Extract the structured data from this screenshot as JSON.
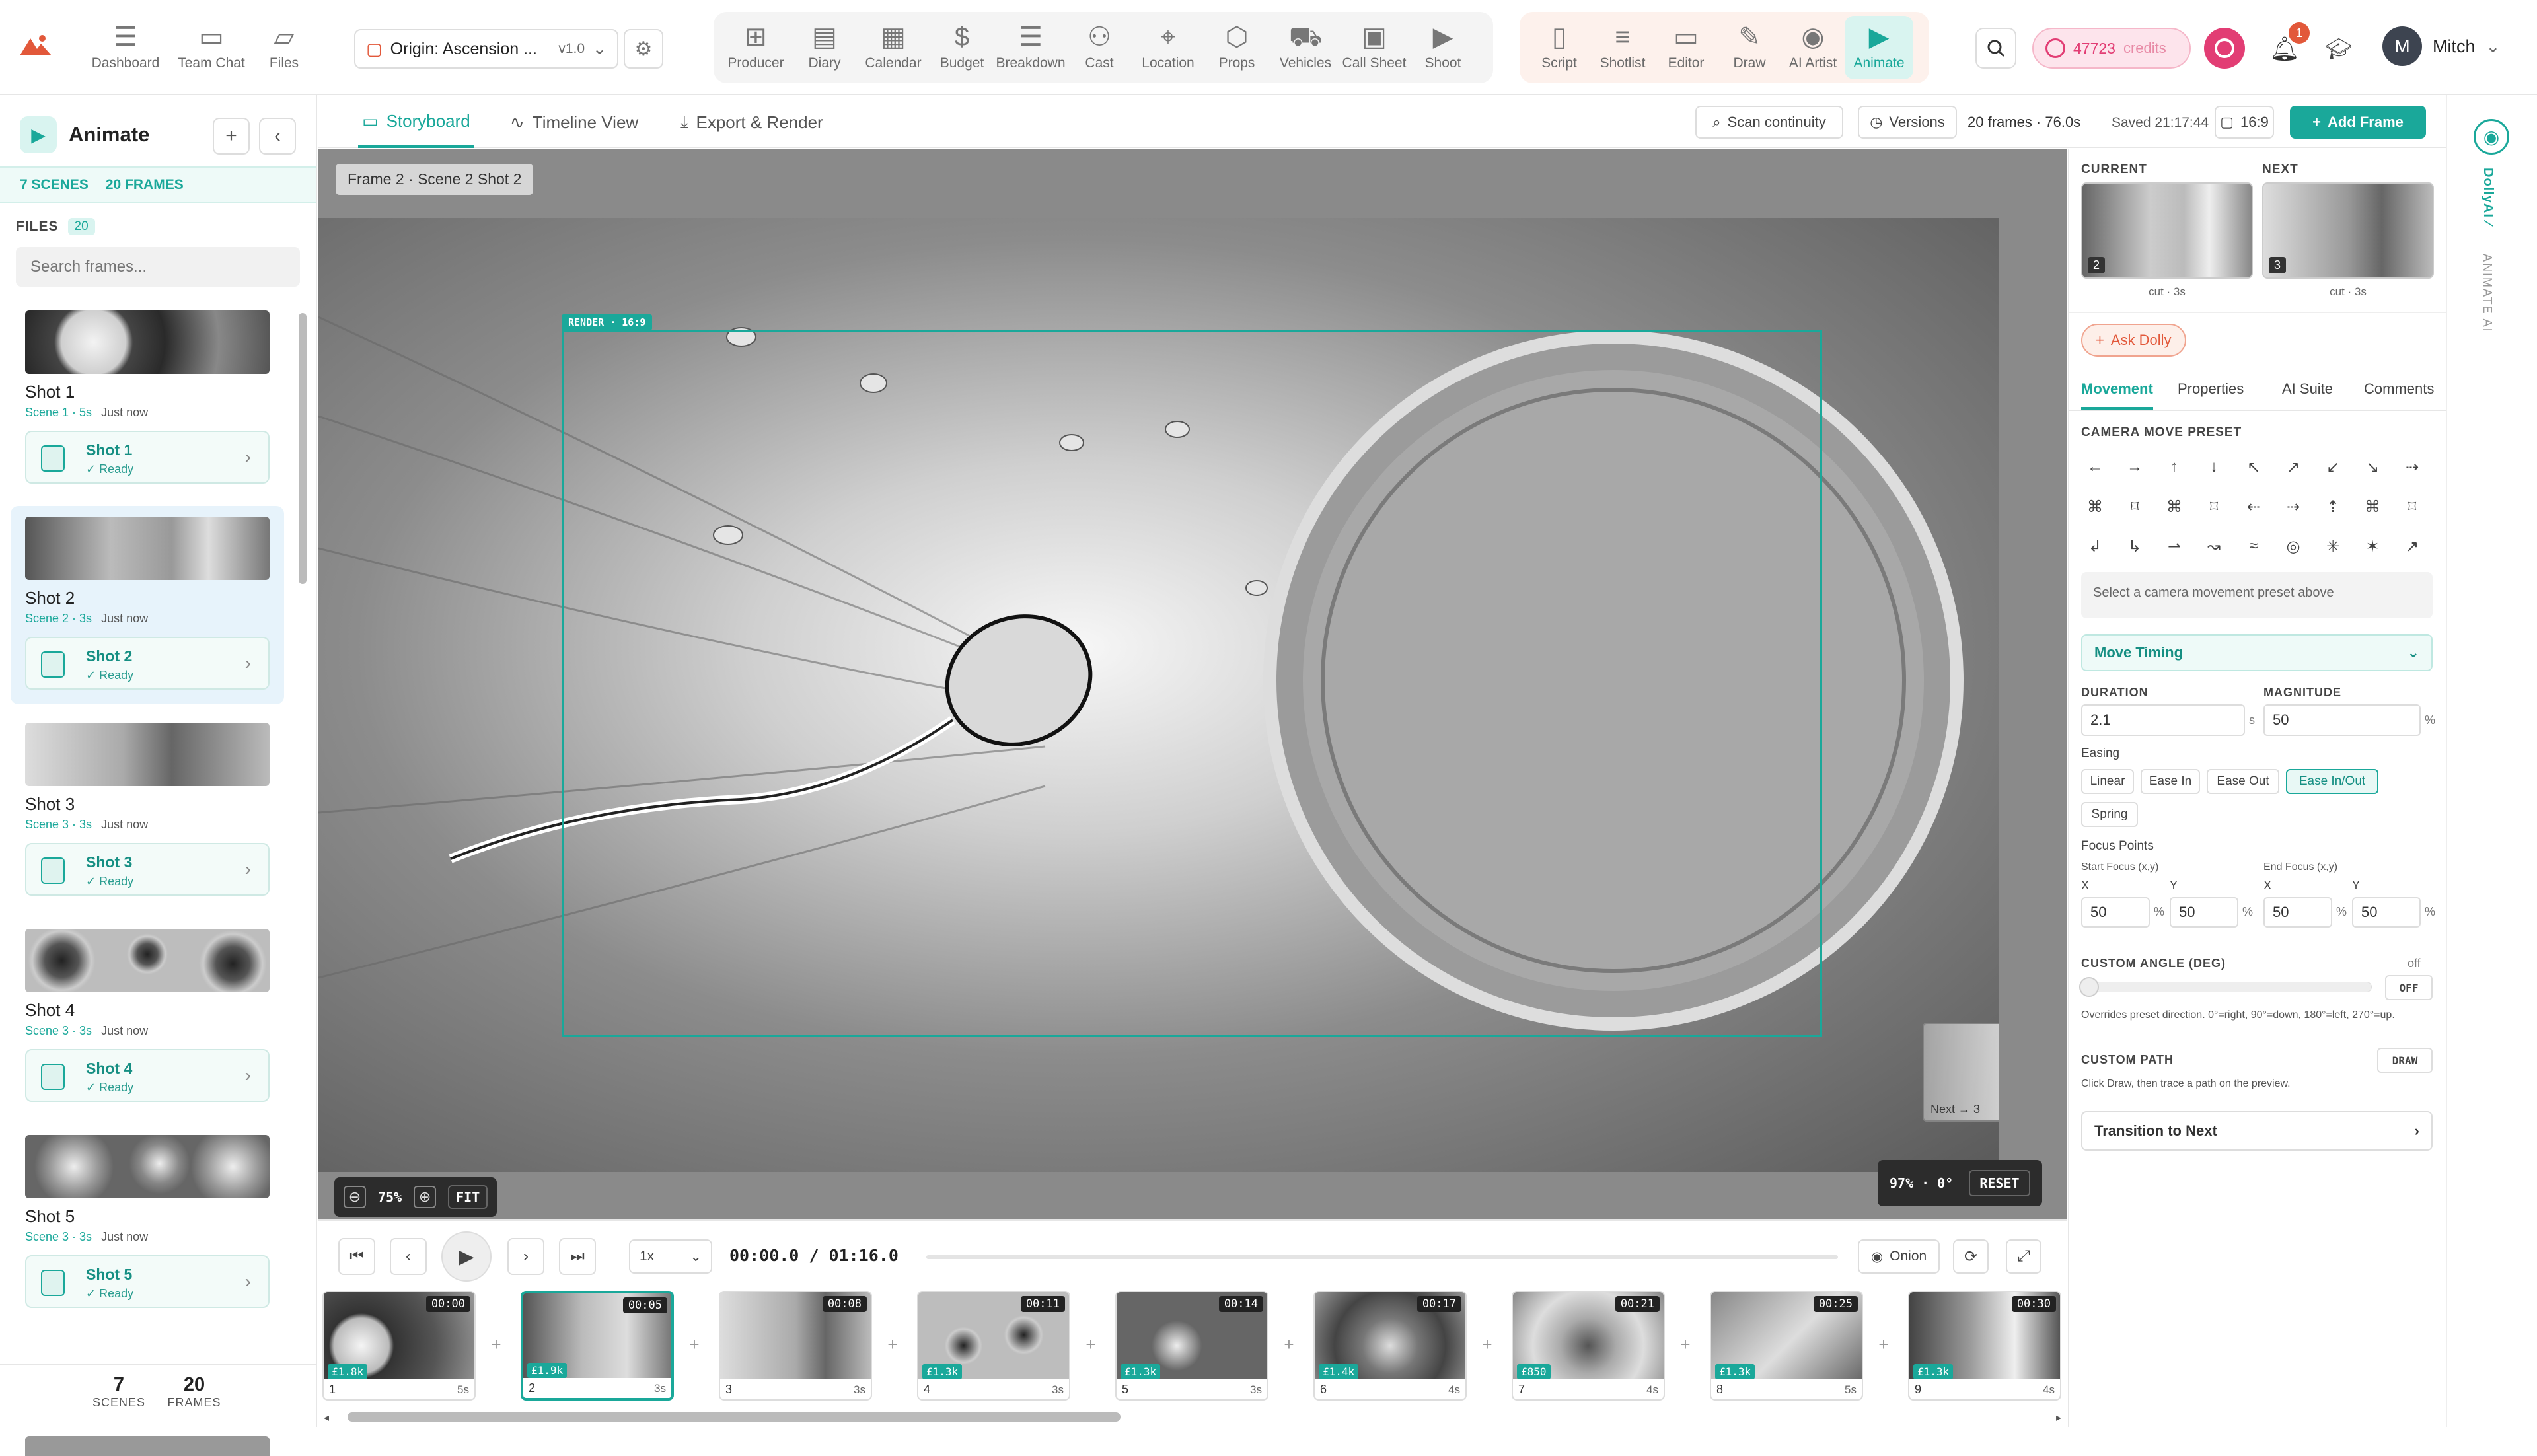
{
  "topbar": {
    "nav_left": [
      {
        "label": "Dashboard",
        "icon": "hamburger-icon"
      },
      {
        "label": "Team Chat",
        "icon": "chat-icon"
      },
      {
        "label": "Files",
        "icon": "folder-icon"
      }
    ],
    "project": {
      "name": "Origin: Ascension ...",
      "version": "v1.0"
    },
    "nav_production": [
      {
        "label": "Producer",
        "icon": "producer-icon"
      },
      {
        "label": "Diary",
        "icon": "diary-icon"
      },
      {
        "label": "Calendar",
        "icon": "calendar-icon"
      },
      {
        "label": "Budget",
        "icon": "dollar-icon"
      },
      {
        "label": "Breakdown",
        "icon": "breakdown-icon"
      },
      {
        "label": "Cast",
        "icon": "cast-icon"
      },
      {
        "label": "Location",
        "icon": "location-pin-icon"
      },
      {
        "label": "Props",
        "icon": "cube-icon"
      },
      {
        "label": "Vehicles",
        "icon": "vehicle-icon"
      },
      {
        "label": "Call Sheet",
        "icon": "clipboard-icon"
      },
      {
        "label": "Shoot",
        "icon": "camera-icon"
      }
    ],
    "nav_creative": [
      {
        "label": "Script",
        "icon": "script-icon"
      },
      {
        "label": "Shotlist",
        "icon": "list-icon"
      },
      {
        "label": "Editor",
        "icon": "editor-icon"
      },
      {
        "label": "Draw",
        "icon": "pencil-icon"
      },
      {
        "label": "AI Artist",
        "icon": "eye-icon"
      },
      {
        "label": "Animate",
        "icon": "animate-icon"
      }
    ],
    "credits": "47723",
    "credits_label": "credits",
    "notifications": "1",
    "user_initial": "M",
    "user_name": "Mitch"
  },
  "left": {
    "title": "Animate",
    "scenes_count": "7 SCENES",
    "frames_count": "20 FRAMES",
    "files_label": "FILES",
    "files_count": "20",
    "search_placeholder": "Search frames...",
    "shots": [
      {
        "name": "Shot 1",
        "scene": "Scene 1 · 5s",
        "time": "Just now",
        "btn": "Shot 1",
        "status": "✓ Ready"
      },
      {
        "name": "Shot 2",
        "scene": "Scene 2 · 3s",
        "time": "Just now",
        "btn": "Shot 2",
        "status": "✓ Ready"
      },
      {
        "name": "Shot 3",
        "scene": "Scene 3 · 3s",
        "time": "Just now",
        "btn": "Shot 3",
        "status": "✓ Ready"
      },
      {
        "name": "Shot 4",
        "scene": "Scene 3 · 3s",
        "time": "Just now",
        "btn": "Shot 4",
        "status": "✓ Ready"
      },
      {
        "name": "Shot 5",
        "scene": "Scene 3 · 3s",
        "time": "Just now",
        "btn": "Shot 5",
        "status": "✓ Ready"
      }
    ],
    "footer": {
      "scenes_num": "7",
      "scenes_label": "SCENES",
      "frames_num": "20",
      "frames_label": "FRAMES"
    }
  },
  "tabs": {
    "storyboard": "Storyboard",
    "timeline": "Timeline View",
    "export": "Export & Render",
    "scan": "Scan continuity",
    "versions": "Versions",
    "summary": "20 frames · 76.0s",
    "saved": "Saved 21:17:44",
    "ratio": "16:9",
    "add_frame": "Add Frame"
  },
  "canvas": {
    "frame_label": "Frame 2 · Scene 2 Shot 2",
    "render_tag": "RENDER · 16:9",
    "zoom": "75%",
    "fit": "FIT",
    "view": "97% · 0°",
    "reset": "RESET",
    "next_label": "Next → 3"
  },
  "right": {
    "current_label": "CURRENT",
    "next_label": "NEXT",
    "current_num": "2",
    "next_num": "3",
    "current_meta": "cut · 3s",
    "next_meta": "cut · 3s",
    "ask": "Ask Dolly",
    "tabs": [
      "Movement",
      "Properties",
      "AI Suite",
      "Comments"
    ],
    "camera_title": "CAMERA MOVE PRESET",
    "camera_icons": [
      "←",
      "→",
      "↑",
      "↓",
      "↖",
      "↗",
      "↙",
      "↘",
      "⇢",
      "⌘",
      "⌑",
      "⌘",
      "⌑",
      "⇠",
      "⇢",
      "⇡",
      "⌘",
      "⌑",
      "↲",
      "↳",
      "⇀",
      "↝",
      "≈",
      "◎",
      "✳",
      "✶",
      "↗"
    ],
    "camera_hint": "Select a camera movement preset above",
    "move_timing": "Move Timing",
    "duration_label": "DURATION",
    "duration": "2.1",
    "duration_unit": "s",
    "magnitude_label": "MAGNITUDE",
    "magnitude": "50",
    "magnitude_unit": "%",
    "easing_label": "Easing",
    "easing": [
      "Linear",
      "Ease In",
      "Ease Out",
      "Ease In/Out",
      "Spring"
    ],
    "focus_label": "Focus Points",
    "start_focus": "Start Focus (x,y)",
    "end_focus": "End Focus (x,y)",
    "x": "X",
    "y": "Y",
    "sx": "50",
    "sy": "50",
    "ex": "50",
    "ey": "50",
    "pct": "%",
    "angle_label": "CUSTOM ANGLE (DEG)",
    "angle_state": "off",
    "angle_btn": "OFF",
    "angle_hint": "Overrides preset direction. 0°=right, 90°=down, 180°=left, 270°=up.",
    "path_label": "CUSTOM PATH",
    "path_btn": "DRAW",
    "path_hint": "Click Draw, then trace a path on the preview.",
    "transition": "Transition to Next"
  },
  "rail": {
    "a": "DollyAI ⁄",
    "b": "ANIMATE AI"
  },
  "transport": {
    "speed": "1x",
    "time": "00:00.0 / 01:16.0",
    "onion": "Onion"
  },
  "strip": [
    {
      "time": "00:00",
      "cost": "£1.8k",
      "num": "1",
      "dur": "5s"
    },
    {
      "time": "00:05",
      "cost": "£1.9k",
      "num": "2",
      "dur": "3s"
    },
    {
      "time": "00:08",
      "cost": "",
      "num": "3",
      "dur": "3s"
    },
    {
      "time": "00:11",
      "cost": "£1.3k",
      "num": "4",
      "dur": "3s"
    },
    {
      "time": "00:14",
      "cost": "£1.3k",
      "num": "5",
      "dur": "3s"
    },
    {
      "time": "00:17",
      "cost": "£1.4k",
      "num": "6",
      "dur": "4s"
    },
    {
      "time": "00:21",
      "cost": "£850",
      "num": "7",
      "dur": "4s"
    },
    {
      "time": "00:25",
      "cost": "£1.3k",
      "num": "8",
      "dur": "5s"
    },
    {
      "time": "00:30",
      "cost": "£1.3k",
      "num": "9",
      "dur": "4s"
    }
  ],
  "colors": {
    "accent": "#1aa89a",
    "brand": "#e2583a",
    "credits": "#e23d74"
  }
}
